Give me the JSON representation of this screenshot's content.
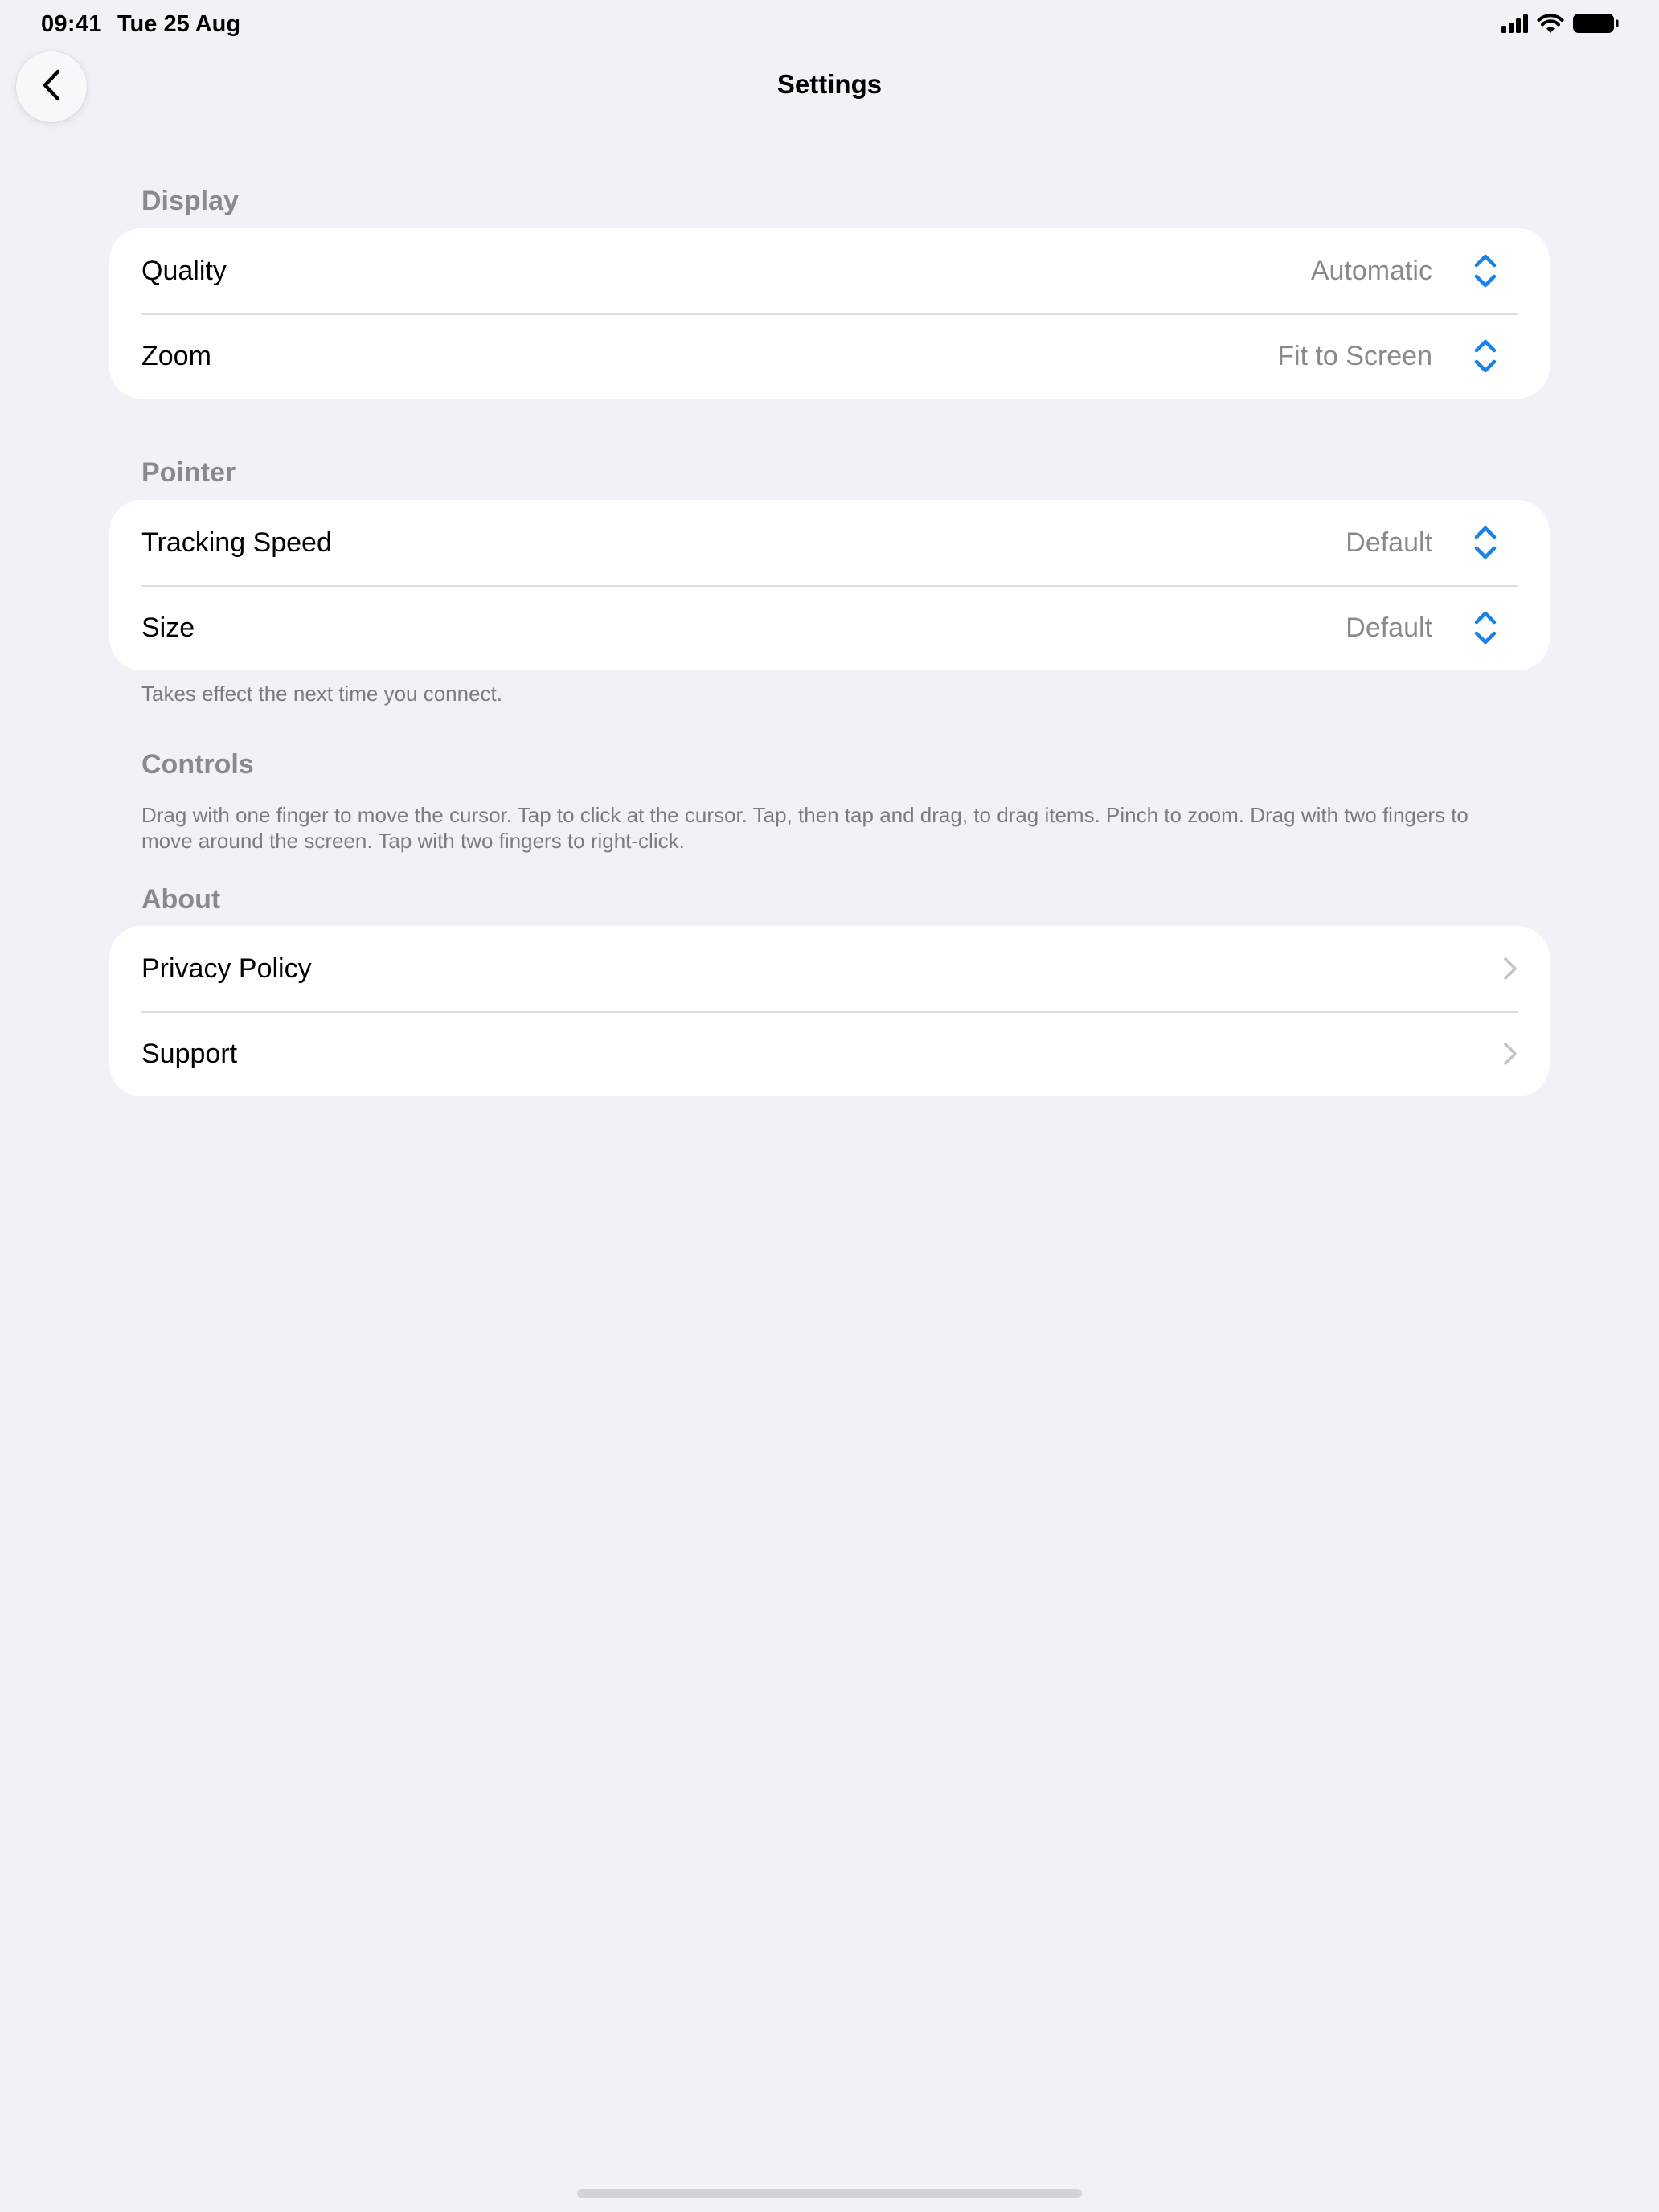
{
  "status_bar": {
    "time": "09:41",
    "date": "Tue 25 Aug"
  },
  "nav": {
    "title": "Settings"
  },
  "sections": {
    "display": {
      "header": "Display",
      "rows": [
        {
          "label": "Quality",
          "value": "Automatic"
        },
        {
          "label": "Zoom",
          "value": "Fit to Screen"
        }
      ]
    },
    "pointer": {
      "header": "Pointer",
      "rows": [
        {
          "label": "Tracking Speed",
          "value": "Default"
        },
        {
          "label": "Size",
          "value": "Default"
        }
      ],
      "footer": "Takes effect the next time you connect."
    },
    "controls": {
      "header": "Controls",
      "description": "Drag with one finger to move the cursor. Tap to click at the cursor. Tap, then tap and drag, to drag items. Pinch to zoom. Drag with two fingers to move around the screen. Tap with two fingers to right-click."
    },
    "about": {
      "header": "About",
      "rows": [
        {
          "label": "Privacy Policy"
        },
        {
          "label": "Support"
        }
      ]
    }
  },
  "icons": {
    "back": "chevron-left-icon",
    "stepper": "up-down-chevron-icon",
    "disclosure": "chevron-right-icon",
    "signal": "cellular-signal-icon",
    "wifi": "wifi-icon",
    "battery": "battery-icon"
  },
  "colors": {
    "background": "#f2f1f7",
    "accent": "#1a82e6",
    "secondary_text": "#8a8a8e",
    "separator": "#dedee2"
  }
}
